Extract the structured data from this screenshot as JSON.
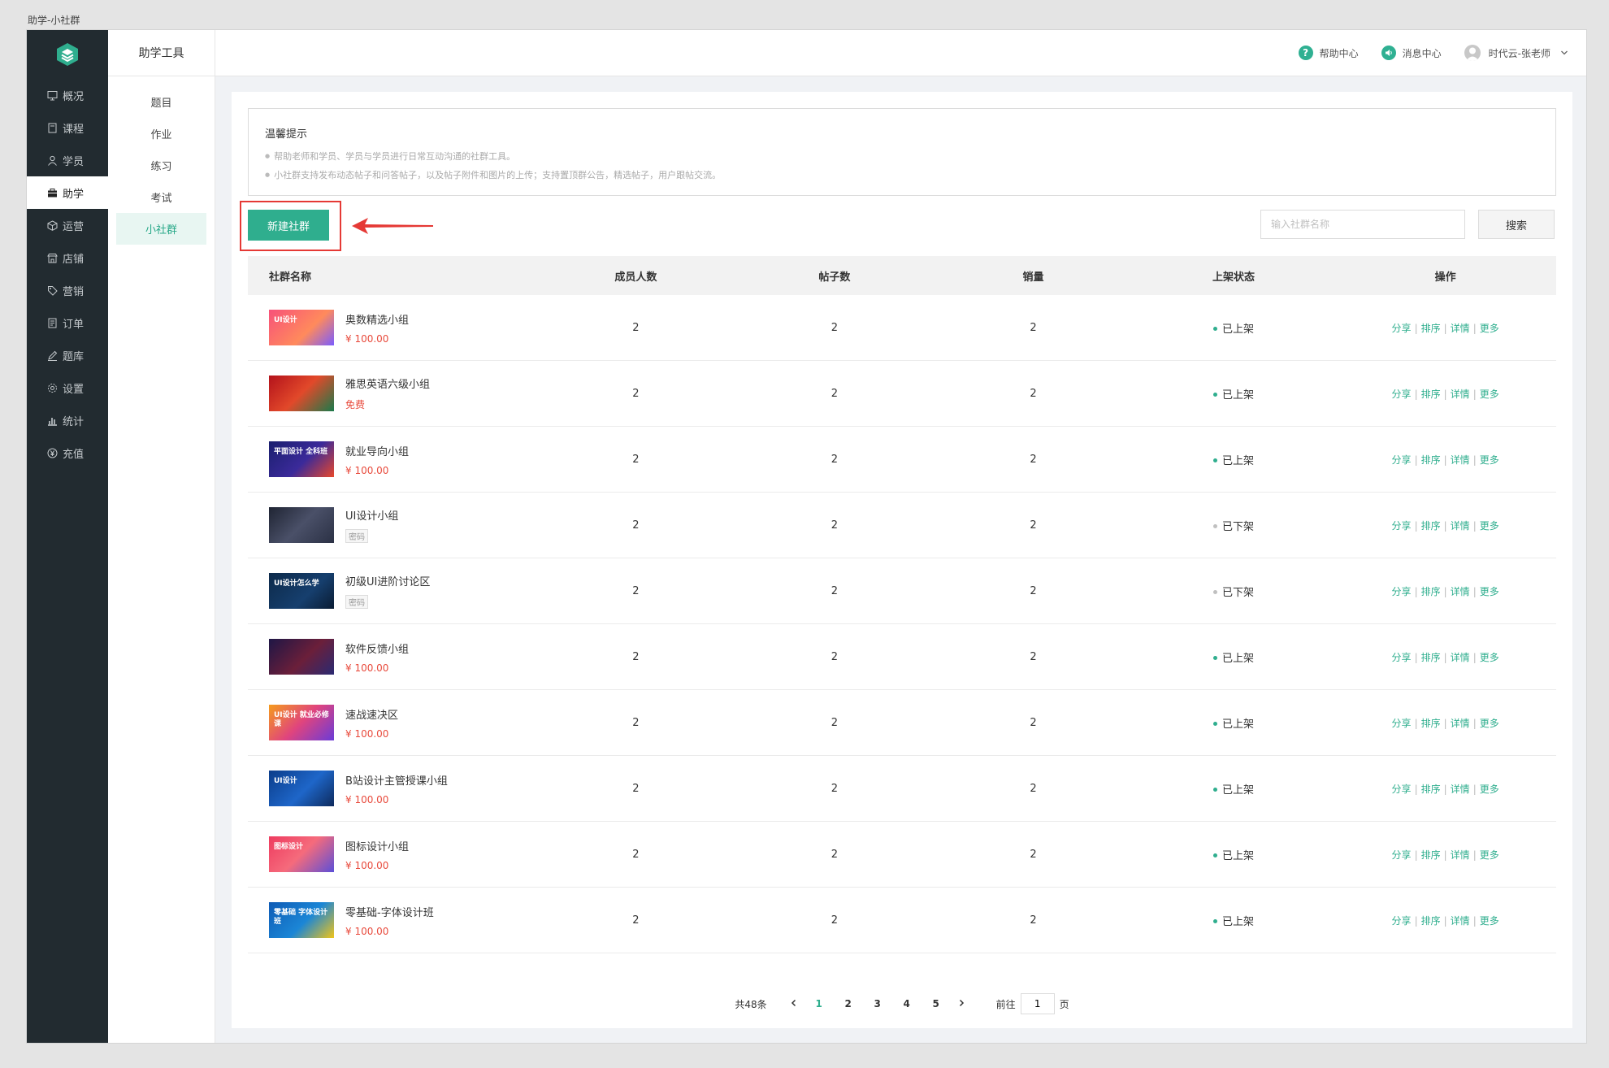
{
  "window_caption": "助学-小社群",
  "colors": {
    "accent": "#2fae8e",
    "sidebar_bg": "#222b30",
    "price": "#e84a3c",
    "highlight": "#e53935"
  },
  "sidebar": {
    "items": [
      {
        "label": "概况",
        "icon": "monitor-icon"
      },
      {
        "label": "课程",
        "icon": "book-icon"
      },
      {
        "label": "学员",
        "icon": "user-icon"
      },
      {
        "label": "助学",
        "icon": "briefcase-icon",
        "active": true
      },
      {
        "label": "运营",
        "icon": "cube-icon"
      },
      {
        "label": "店铺",
        "icon": "store-icon"
      },
      {
        "label": "营销",
        "icon": "tag-icon"
      },
      {
        "label": "订单",
        "icon": "document-icon"
      },
      {
        "label": "题库",
        "icon": "pencil-icon"
      },
      {
        "label": "设置",
        "icon": "gear-icon"
      },
      {
        "label": "统计",
        "icon": "bar-chart-icon"
      },
      {
        "label": "充值",
        "icon": "yen-icon"
      }
    ]
  },
  "submenu": {
    "title": "助学工具",
    "items": [
      {
        "label": "题目"
      },
      {
        "label": "作业"
      },
      {
        "label": "练习"
      },
      {
        "label": "考试"
      },
      {
        "label": "小社群",
        "active": true
      }
    ]
  },
  "header": {
    "help": "帮助中心",
    "messages": "消息中心",
    "user": "时代云-张老师"
  },
  "notice": {
    "title": "温馨提示",
    "lines": [
      "帮助老师和学员、学员与学员进行日常互动沟通的社群工具。",
      "小社群支持发布动态帖子和问答帖子，以及帖子附件和图片的上传；支持置顶群公告，精选帖子，用户跟帖交流。"
    ]
  },
  "toolbar": {
    "create_label": "新建社群",
    "search_placeholder": "输入社群名称",
    "search_label": "搜索"
  },
  "table": {
    "columns": [
      "社群名称",
      "成员人数",
      "帖子数",
      "销量",
      "上架状态",
      "操作"
    ],
    "ops": [
      "分享",
      "排序",
      "详情",
      "更多"
    ],
    "rows": [
      {
        "name": "奥数精选小组",
        "price": "¥ 100.00",
        "members": "2",
        "posts": "2",
        "sales": "2",
        "status": "已上架",
        "on": true,
        "thumb_text": "UI设计",
        "thumb_bg": "linear-gradient(135deg,#f7517a,#ff8a5c 60%,#7a5cff)"
      },
      {
        "name": "雅思英语六级小组",
        "price": "免费",
        "members": "2",
        "posts": "2",
        "sales": "2",
        "status": "已上架",
        "on": true,
        "thumb_text": "",
        "thumb_bg": "linear-gradient(135deg,#b3121b,#e2492a 50%,#1a7a4a)"
      },
      {
        "name": "就业导向小组",
        "price": "¥ 100.00",
        "members": "2",
        "posts": "2",
        "sales": "2",
        "status": "已上架",
        "on": true,
        "thumb_text": "平面设计 全科班",
        "thumb_bg": "linear-gradient(135deg,#1a1f6e,#3b2a9a 55%,#e8472b)"
      },
      {
        "name": "UI设计小组",
        "tag": "密码",
        "members": "2",
        "posts": "2",
        "sales": "2",
        "status": "已下架",
        "on": false,
        "thumb_text": "",
        "thumb_bg": "linear-gradient(135deg,#1f2433,#4a5068 50%,#2b3145)"
      },
      {
        "name": "初级UI进阶讨论区",
        "tag": "密码",
        "members": "2",
        "posts": "2",
        "sales": "2",
        "status": "已下架",
        "on": false,
        "thumb_text": "UI设计怎么学",
        "thumb_bg": "linear-gradient(135deg,#0d2a4a,#163f6e 60%,#0a1c33)"
      },
      {
        "name": "软件反馈小组",
        "price": "¥ 100.00",
        "members": "2",
        "posts": "2",
        "sales": "2",
        "status": "已上架",
        "on": true,
        "thumb_text": "",
        "thumb_bg": "linear-gradient(135deg,#1e1646,#6b1f3a 55%,#2a2a72)"
      },
      {
        "name": "速战速决区",
        "price": "¥ 100.00",
        "members": "2",
        "posts": "2",
        "sales": "2",
        "status": "已上架",
        "on": true,
        "thumb_text": "UI设计 就业必修课",
        "thumb_bg": "linear-gradient(135deg,#f59b1c,#e0447e 50%,#6a3bd8)"
      },
      {
        "name": "B站设计主管授课小组",
        "price": "¥ 100.00",
        "members": "2",
        "posts": "2",
        "sales": "2",
        "status": "已上架",
        "on": true,
        "thumb_text": "UI设计",
        "thumb_bg": "linear-gradient(135deg,#0b3d8a,#1e66c9 55%,#0e2a5c)"
      },
      {
        "name": "图标设计小组",
        "price": "¥ 100.00",
        "members": "2",
        "posts": "2",
        "sales": "2",
        "status": "已上架",
        "on": true,
        "thumb_text": "图标设计",
        "thumb_bg": "linear-gradient(135deg,#ee3b5f,#f56b7c 50%,#5b4fd8)"
      },
      {
        "name": "零基础-字体设计班",
        "price": "¥ 100.00",
        "members": "2",
        "posts": "2",
        "sales": "2",
        "status": "已上架",
        "on": true,
        "thumb_text": "零基础 字体设计班",
        "thumb_bg": "linear-gradient(135deg,#0f5bb5,#1b86d6 55%,#f0c419)"
      }
    ]
  },
  "pager": {
    "total": "共48条",
    "pages": [
      "1",
      "2",
      "3",
      "4",
      "5"
    ],
    "current": "1",
    "goto_prefix": "前往",
    "goto_value": "1",
    "goto_suffix": "页"
  }
}
